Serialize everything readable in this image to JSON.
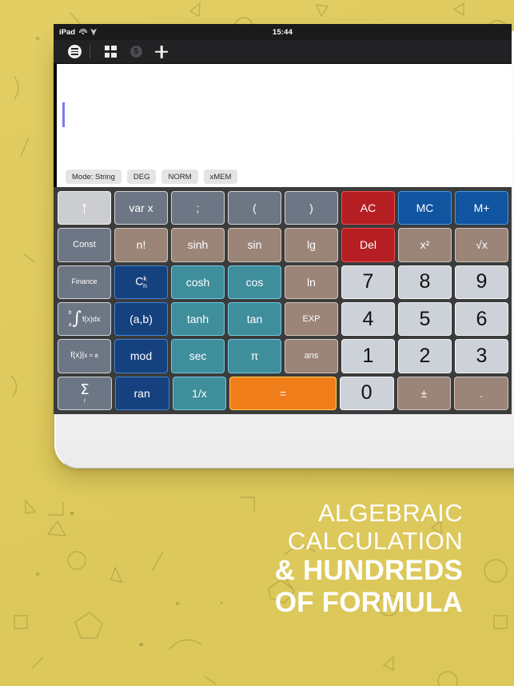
{
  "background": {
    "color": "#e0cc60",
    "shape_color": "rgba(150,132,55,0.45)"
  },
  "device": {
    "name": "ipad-landscape",
    "bezel_color": "#f6f6f7",
    "home_button": "home-button"
  },
  "status_bar": {
    "device_label": "iPad",
    "wifi_icon": "wifi-icon",
    "location_icon": "location-arrow-icon",
    "time": "15:44"
  },
  "toolbar": {
    "menu_icon": "hamburger-menu-icon",
    "grid_icon": "grid-apps-icon",
    "currency_icon": "dollar-circle-icon",
    "currency_label": "$",
    "add_icon": "plus-icon"
  },
  "display": {
    "value": "",
    "caret_color": "#7b7bf5"
  },
  "mode_bar": {
    "chips": [
      {
        "name": "mode-chip",
        "label": "Mode: String"
      },
      {
        "name": "angle-chip",
        "label": "DEG"
      },
      {
        "name": "notation-chip",
        "label": "NORM"
      },
      {
        "name": "memory-chip",
        "label": "xMEM"
      }
    ]
  },
  "keypad": {
    "rows": [
      [
        {
          "label": "↑",
          "style": "k-shift",
          "name": "shift-key",
          "size": "arrow"
        },
        {
          "label": "var x",
          "style": "k-slate",
          "name": "var-x-key"
        },
        {
          "label": ";",
          "style": "k-slate",
          "name": "semicolon-key"
        },
        {
          "label": "(",
          "style": "k-slate",
          "name": "open-paren-key"
        },
        {
          "label": ")",
          "style": "k-slate",
          "name": "close-paren-key"
        },
        {
          "label": "AC",
          "style": "k-red",
          "name": "all-clear-key"
        },
        {
          "label": "MC",
          "style": "k-blue",
          "name": "memory-clear-key"
        },
        {
          "label": "M+",
          "style": "k-blue",
          "name": "memory-plus-key"
        }
      ],
      [
        {
          "label": "Const",
          "style": "k-slate",
          "name": "constants-key",
          "size": "small"
        },
        {
          "label": "n!",
          "style": "k-tan",
          "name": "factorial-key"
        },
        {
          "label": "sinh",
          "style": "k-tan",
          "name": "sinh-key"
        },
        {
          "label": "sin",
          "style": "k-tan",
          "name": "sin-key"
        },
        {
          "label": "lg",
          "style": "k-tan",
          "name": "log10-key"
        },
        {
          "label": "Del",
          "style": "k-red",
          "name": "delete-key"
        },
        {
          "label": "x²",
          "style": "k-tan",
          "name": "square-key"
        },
        {
          "label": "√x",
          "style": "k-tan",
          "name": "square-root-key"
        }
      ],
      [
        {
          "label": "Finance",
          "style": "k-slate",
          "name": "finance-key",
          "size": "tiny"
        },
        {
          "label": "C",
          "style": "k-navy",
          "name": "combination-key",
          "glyph": "combination"
        },
        {
          "label": "cosh",
          "style": "k-teal",
          "name": "cosh-key"
        },
        {
          "label": "cos",
          "style": "k-teal",
          "name": "cos-key"
        },
        {
          "label": "ln",
          "style": "k-tan",
          "name": "natural-log-key"
        },
        {
          "label": "7",
          "style": "k-num",
          "name": "digit-7-key"
        },
        {
          "label": "8",
          "style": "k-num",
          "name": "digit-8-key"
        },
        {
          "label": "9",
          "style": "k-num",
          "name": "digit-9-key"
        }
      ],
      [
        {
          "label": "∫ f(x)dx",
          "style": "k-slate",
          "name": "integral-key",
          "glyph": "integral"
        },
        {
          "label": "(a,b)",
          "style": "k-navy",
          "name": "interval-key"
        },
        {
          "label": "tanh",
          "style": "k-teal",
          "name": "tanh-key"
        },
        {
          "label": "tan",
          "style": "k-teal",
          "name": "tan-key"
        },
        {
          "label": "EXP",
          "style": "k-tan",
          "name": "exponent-key",
          "size": "small"
        },
        {
          "label": "4",
          "style": "k-num",
          "name": "digit-4-key"
        },
        {
          "label": "5",
          "style": "k-num",
          "name": "digit-5-key"
        },
        {
          "label": "6",
          "style": "k-num",
          "name": "digit-6-key"
        }
      ],
      [
        {
          "label": "f(x)|x = a",
          "style": "k-slate",
          "name": "evaluate-key",
          "glyph": "evaluate"
        },
        {
          "label": "mod",
          "style": "k-navy",
          "name": "modulo-key"
        },
        {
          "label": "sec",
          "style": "k-teal",
          "name": "secant-key"
        },
        {
          "label": "π",
          "style": "k-teal",
          "name": "pi-key"
        },
        {
          "label": "ans",
          "style": "k-tan",
          "name": "answer-key",
          "size": "small"
        },
        {
          "label": "1",
          "style": "k-num",
          "name": "digit-1-key"
        },
        {
          "label": "2",
          "style": "k-num",
          "name": "digit-2-key"
        },
        {
          "label": "3",
          "style": "k-num",
          "name": "digit-3-key"
        }
      ],
      [
        {
          "label": "Σ i",
          "style": "k-slate",
          "name": "summation-key",
          "glyph": "sum"
        },
        {
          "label": "ran",
          "style": "k-navy",
          "name": "random-key"
        },
        {
          "label": "1/x",
          "style": "k-teal",
          "name": "reciprocal-key"
        },
        {
          "label": "=",
          "style": "k-eq",
          "name": "equals-key",
          "wide": true
        },
        {
          "label": "0",
          "style": "k-num",
          "name": "digit-0-key"
        },
        {
          "label": "±",
          "style": "k-tan",
          "name": "sign-toggle-key"
        },
        {
          "label": ".",
          "style": "k-tan",
          "name": "decimal-point-key"
        }
      ]
    ],
    "combination_glyph": {
      "base": "C",
      "sup": "k",
      "sub": "n"
    },
    "integral_glyph": {
      "upper": "b",
      "lower": "a",
      "body": "f(x)dx"
    },
    "evaluate_glyph": {
      "base": "f(x)|",
      "sub": "x = a"
    },
    "sum_glyph": {
      "sigma": "Σ",
      "index": "i"
    }
  },
  "marketing": {
    "line1": "ALGEBRAIC",
    "line2": "CALCULATION",
    "line3": "& HUNDREDS",
    "line4": "OF FORMULA"
  }
}
